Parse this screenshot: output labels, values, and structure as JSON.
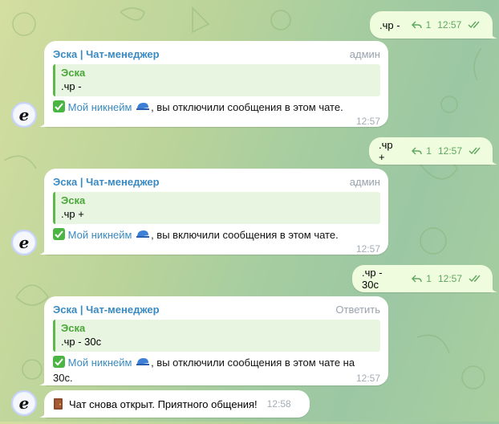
{
  "messages": {
    "out1": {
      "text": ".чр -",
      "replies": "1",
      "time": "12:57"
    },
    "in1": {
      "sender": "Эска | Чат-менеджер",
      "role": "админ",
      "quote_name": "Эска",
      "quote_text": ".чр -",
      "nick": "Мой никнейм",
      "body": ", вы отключили сообщения в этом чате.",
      "time": "12:57"
    },
    "out2": {
      "text": ".чр +",
      "replies": "1",
      "time": "12:57"
    },
    "in2": {
      "sender": "Эска | Чат-менеджер",
      "role": "админ",
      "quote_name": "Эска",
      "quote_text": ".чр +",
      "nick": "Мой никнейм",
      "body": ", вы включили сообщения в этом чате.",
      "time": "12:57"
    },
    "out3": {
      "text": ".чр - 30с",
      "replies": "1",
      "time": "12:57"
    },
    "in3": {
      "sender": "Эска | Чат-менеджер",
      "role": "Ответить",
      "quote_name": "Эска",
      "quote_text": ".чр - 30с",
      "nick": "Мой никнейм",
      "body_line1": ", вы отключили сообщения в этом чате на",
      "body_line2": "30с.",
      "time": "12:57"
    },
    "service": {
      "text": "Чат снова открыт. Приятного общения!",
      "time": "12:58"
    }
  },
  "avatar_letter": "e",
  "colors": {
    "outgoing_bubble": "#effdde",
    "incoming_bubble": "#ffffff",
    "link": "#3a8ac1",
    "quote_accent": "#5fb84a",
    "meta_green": "#5fa760"
  }
}
